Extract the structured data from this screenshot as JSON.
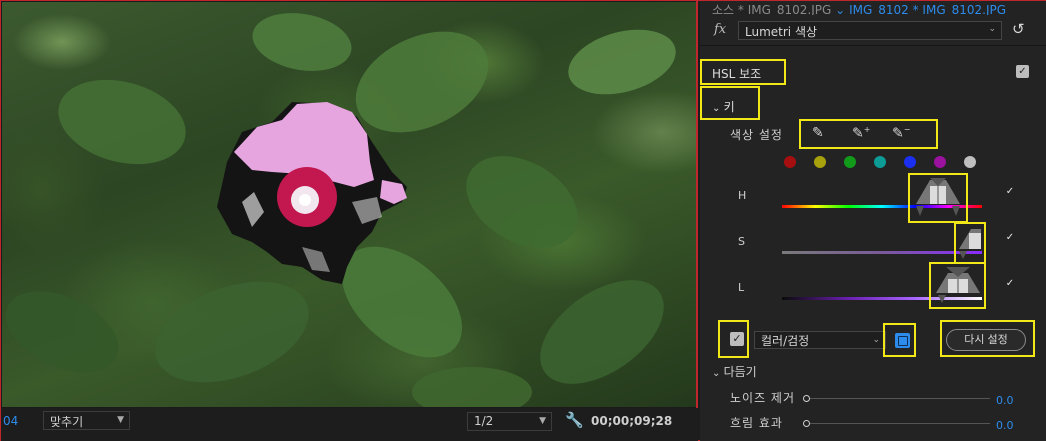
{
  "monitor": {
    "timecode_left": "04",
    "fit_label": "맞추기",
    "resolution_label": "1/2",
    "timecode_right": "00;00;09;28"
  },
  "panel": {
    "source_prefix": "소스 * IMG_8102.JPG",
    "source_arrow": "⌄",
    "source_clip": "IMG_8102 * IMG_8102.JPG",
    "fx_label": "fx",
    "effect_name": "Lumetri 색상",
    "hsl_title": "HSL 보조",
    "key_title": "키",
    "color_set_label": "색상 설정",
    "channels": [
      {
        "label": "H",
        "checked": true
      },
      {
        "label": "S",
        "checked": true
      },
      {
        "label": "L",
        "checked": true
      }
    ],
    "swatch_colors": [
      "#a50f0f",
      "#a6a10c",
      "#129a1b",
      "#0c9b95",
      "#1a2fef",
      "#9a129d",
      "#bfbfbf"
    ],
    "mode_label": "컬러/검정",
    "reset_label": "다시 설정",
    "refine_title": "다듬기",
    "denoise_label": "노이즈 제거",
    "denoise_value": "0.0",
    "blur_label": "흐림 효과",
    "blur_value": "0.0"
  },
  "colors": {
    "accent": "#2d8ceb",
    "highlight": "#f2e817",
    "border_red": "#c0272d"
  }
}
